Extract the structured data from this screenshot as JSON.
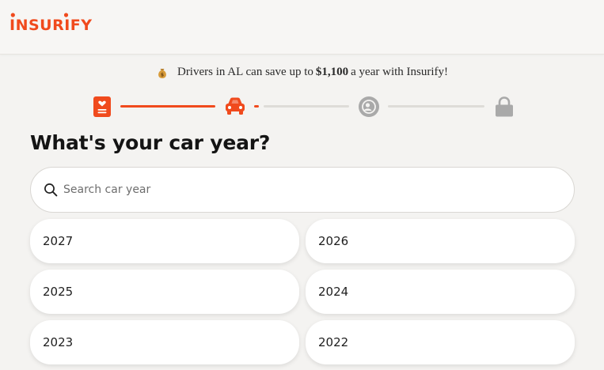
{
  "brand": {
    "logo_text": "INSURIFY",
    "accent_color": "#f04a1d"
  },
  "promo": {
    "icon": "money-bag-icon",
    "text_before": "Drivers in AL can save up to",
    "amount": "$1,100",
    "text_after": "a year with Insurify!"
  },
  "progress": {
    "steps": [
      {
        "icon": "document-heart-icon",
        "status": "complete"
      },
      {
        "icon": "car-icon",
        "status": "current"
      },
      {
        "icon": "driver-icon",
        "status": "upcoming"
      },
      {
        "icon": "lock-icon",
        "status": "upcoming"
      }
    ],
    "colors": {
      "active": "#f04a1d",
      "inactive": "#dedcd8",
      "inactive_icon": "#a9a9a9"
    }
  },
  "main": {
    "title": "What's your car year?",
    "search": {
      "placeholder": "Search car year",
      "value": ""
    },
    "years": [
      "2027",
      "2026",
      "2025",
      "2024",
      "2023",
      "2022"
    ]
  }
}
